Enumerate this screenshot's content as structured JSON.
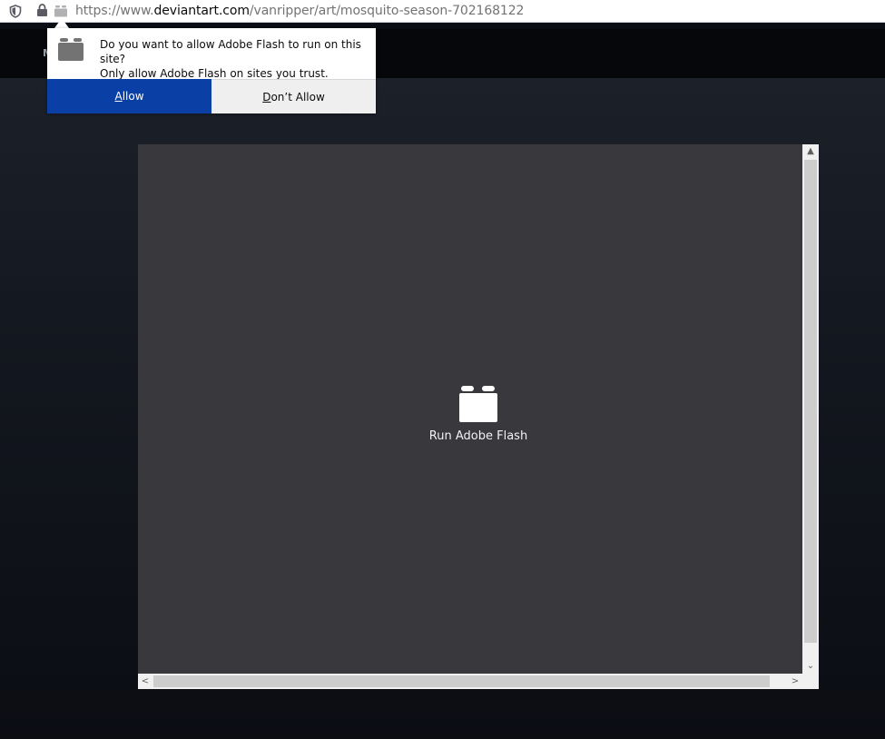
{
  "urlbar": {
    "url_prefix": "https://www.",
    "url_host": "deviantart.com",
    "url_path": "/vanripper/art/mosquito-season-702168122",
    "icons": [
      "shield-icon",
      "lock-icon",
      "plugin-icon"
    ]
  },
  "page": {
    "nav_letter": "M"
  },
  "popup": {
    "message_line1": "Do you want to allow Adobe Flash to run on this site?",
    "message_line2": "Only allow Adobe Flash on sites you trust.",
    "allow_first": "A",
    "allow_rest": "llow",
    "deny_first": "D",
    "deny_rest": "on’t Allow",
    "colors": {
      "allow_bg": "#0a3fa6",
      "deny_bg": "#efefef"
    }
  },
  "flash": {
    "label": "Run Adobe Flash",
    "bg_color": "#38383d"
  }
}
